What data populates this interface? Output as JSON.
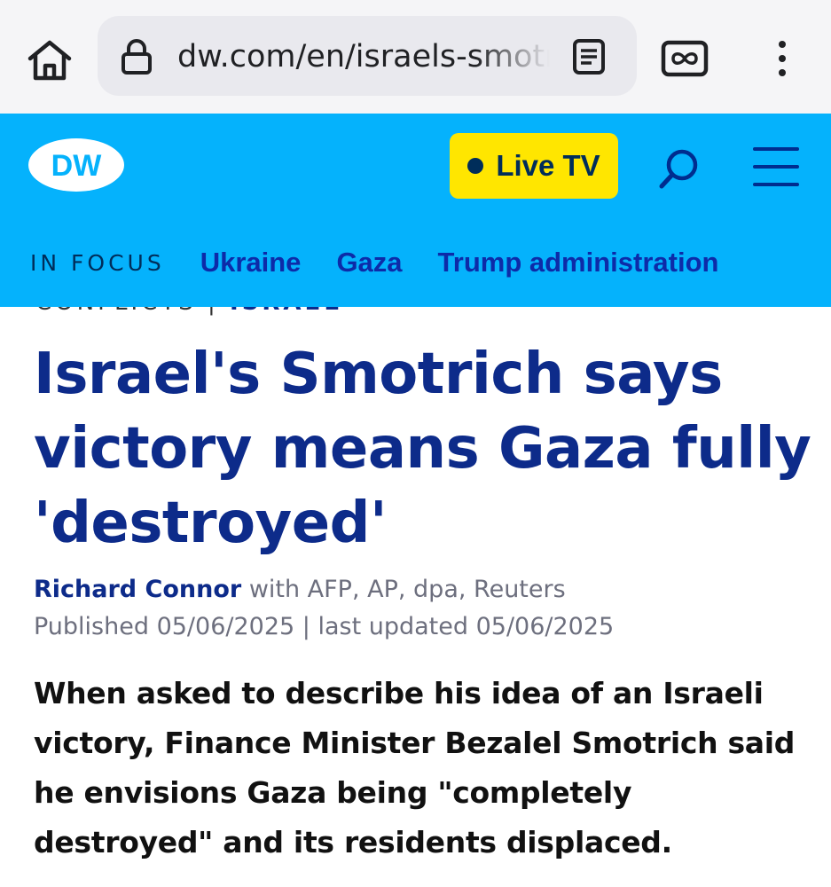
{
  "browser": {
    "url": "dw.com/en/israels-smotrich-says-victory-means-gaza-fully-destroyed",
    "icons": [
      "home-icon",
      "lock-icon",
      "reader-mode-icon",
      "tab-switcher-icon",
      "more-options-icon"
    ]
  },
  "header": {
    "logo_text": "DW",
    "live_tv_label": "Live TV",
    "colors": {
      "header_bg": "#05b2fc",
      "live_bg": "#ffe600",
      "nav_link": "#0d2ba8"
    }
  },
  "focus_nav": {
    "label": "IN FOCUS",
    "links": [
      "Ukraine",
      "Gaza",
      "Trump administration"
    ]
  },
  "article": {
    "category": "CONFLICTS",
    "category_separator": " | ",
    "category_tag": "ISRAEL",
    "headline": "Israel's Smotrich says victory means Gaza fully 'destroyed'",
    "author": "Richard Connor",
    "agencies": "with AFP, AP, dpa, Reuters",
    "published": "Published 05/06/2025 | last updated 05/06/2025",
    "lead": "When asked to describe his idea of an Israeli victory, Finance Minister Bezalel Smotrich said he envisions Gaza being \"completely destroyed\" and its residents displaced."
  }
}
